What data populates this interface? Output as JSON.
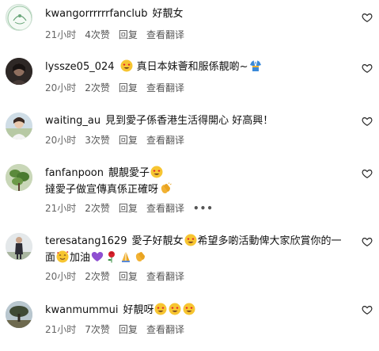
{
  "colors": {
    "text": "#111111",
    "meta": "#666666",
    "heart_stroke": "#222222"
  },
  "actions": {
    "reply": "回复",
    "translate": "查看翻译"
  },
  "comments": [
    {
      "username": "kwangorrrrrrfanclub",
      "text": "好靚女",
      "time": "21小时",
      "likes": "4次赞",
      "avatar": "fanclub-logo"
    },
    {
      "username": "lyssze05_024",
      "text_a": "真日本妹薈和服係靚啲~",
      "time": "20小时",
      "likes": "2次赞",
      "avatar": "dark-portrait"
    },
    {
      "username": "waiting_au",
      "text": "見到愛子係香港生活得開心 好高興！",
      "time": "20小时",
      "likes": "3次赞",
      "avatar": "outdoor-portrait"
    },
    {
      "username": "fanfanpoon",
      "text_line1": "靚靚愛子",
      "text_line2": "撻愛子做宣傳真係正確呀",
      "time": "21小时",
      "likes": "2次赞",
      "more": "•••",
      "avatar": "plant-photo"
    },
    {
      "username": "teresatang1629",
      "text_line1a": "愛子好靚女",
      "text_line1b": "希望多啲活動俾大家欣賞你的一",
      "text_line2a": "面",
      "text_line2b": "加油",
      "time": "20小时",
      "likes": "2次赞",
      "avatar": "standing-figure"
    },
    {
      "username": "kwanmummui",
      "text": "好靚呀",
      "time": "21小时",
      "likes": "7次赞",
      "avatar": "tree-landscape"
    }
  ]
}
